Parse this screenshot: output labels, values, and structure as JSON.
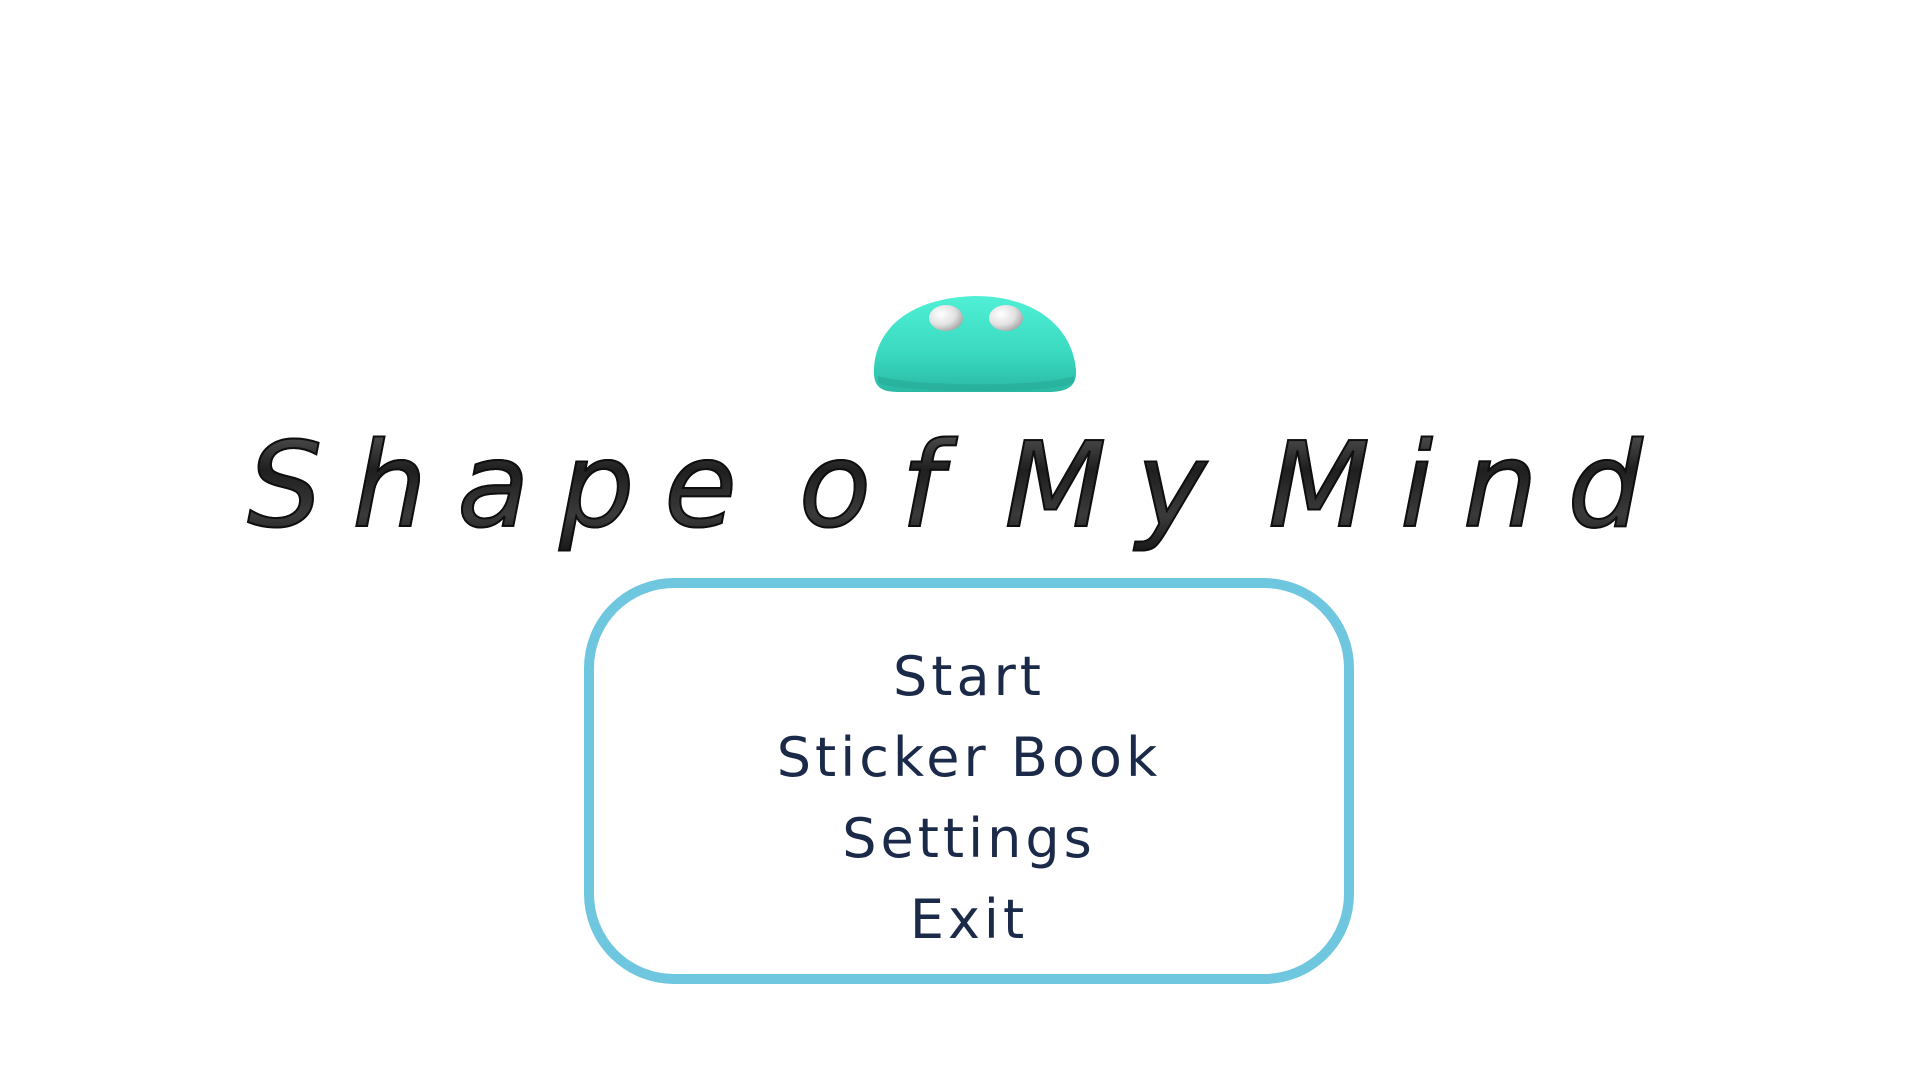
{
  "game": {
    "title_words": [
      "Shape",
      "of",
      "My",
      "Mind"
    ],
    "title_color": "#2a2a2a",
    "mascot": {
      "icon": "teal-blob-creature-icon",
      "body_color": "#3de0c6",
      "eye_color": "#e6e6e6"
    },
    "menu": {
      "border_color": "#6fc6df",
      "text_color": "#1b2a48",
      "items": [
        {
          "label": "Start"
        },
        {
          "label": "Sticker Book"
        },
        {
          "label": "Settings"
        },
        {
          "label": "Exit"
        }
      ]
    }
  }
}
